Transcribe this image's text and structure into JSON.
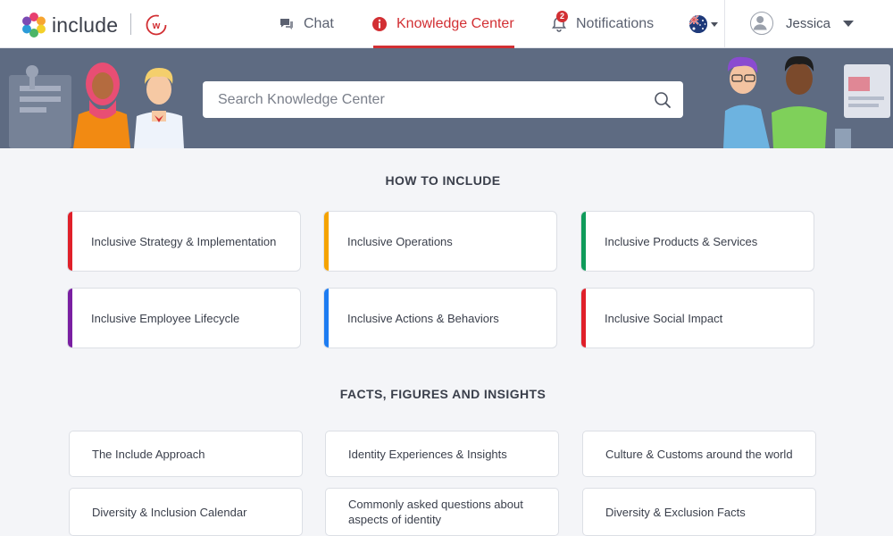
{
  "header": {
    "logo_text": "include",
    "nav": {
      "chat_label": "Chat",
      "knowledge_label": "Knowledge Center",
      "notifications_label": "Notifications",
      "notifications_count": "2"
    },
    "user_name": "Jessica",
    "accent_color": "#d22f33"
  },
  "search": {
    "placeholder": "Search Knowledge Center"
  },
  "how_to_include": {
    "title": "HOW TO INCLUDE",
    "cards": [
      {
        "label": "Inclusive Strategy & Implementation",
        "color": "#e0202a"
      },
      {
        "label": "Inclusive Operations",
        "color": "#f5a300"
      },
      {
        "label": "Inclusive Products & Services",
        "color": "#0f9b5a"
      },
      {
        "label": "Inclusive Employee Lifecycle",
        "color": "#7a1fa2"
      },
      {
        "label": "Inclusive Actions & Behaviors",
        "color": "#1d7cf2"
      },
      {
        "label": "Inclusive Social Impact",
        "color": "#e0202a"
      }
    ]
  },
  "facts": {
    "title": "FACTS, FIGURES AND INSIGHTS",
    "cards": [
      {
        "label": "The Include Approach"
      },
      {
        "label": "Identity Experiences & Insights"
      },
      {
        "label": "Culture & Customs around the world"
      },
      {
        "label": "Diversity & Inclusion Calendar"
      },
      {
        "label": "Commonly asked questions about aspects of identity"
      },
      {
        "label": "Diversity & Exclusion Facts"
      }
    ]
  }
}
